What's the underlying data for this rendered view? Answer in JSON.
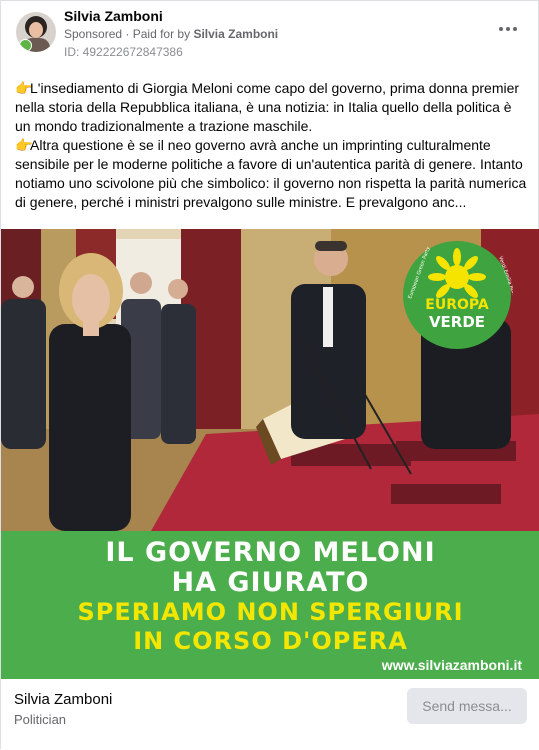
{
  "post": {
    "author": "Silvia Zamboni",
    "sponsored": "Sponsored",
    "paid_prefix": "Paid for by",
    "paid_by": "Silvia Zamboni",
    "library_id": "ID: 492222672847386",
    "paragraph1": "L'insediamento di Giorgia Meloni come capo del governo, prima donna premier nella storia della Repubblica italiana, è una notizia: in Italia quello della politica è un mondo tradizionalmente a trazione maschile.",
    "paragraph2": "Altra questione è se il neo governo avrà anche un imprinting culturalmente sensibile per le moderne politiche a favore di un'autentica parità di genere. Intanto notiamo uno scivolone più che simbolico: il governo non rispetta la parità numerica di genere, perché i ministri prevalgono sulle ministre. E prevalgono anc..."
  },
  "image": {
    "logo_line1": "EUROPA",
    "logo_line2": "VERDE",
    "logo_arc_left": "European Green Party",
    "logo_arc_right": "Verdi Emilia Romagna",
    "headline1": "IL GOVERNO MELONI",
    "headline2": "HA GIURATO",
    "headline3": "SPERIAMO NON SPERGIURI",
    "headline4": "IN CORSO D'OPERA",
    "website": "www.silviazamboni.it"
  },
  "footer": {
    "page_name": "Silvia Zamboni",
    "page_category": "Politician",
    "cta_label": "Send messa..."
  },
  "colors": {
    "banner_green": "#4cad4c",
    "headline_yellow": "#f3e600",
    "carpet_red": "#b0283a",
    "cta_bg": "#e4e6eb"
  },
  "icons": [
    "pointing-hand-icon",
    "more-options-icon",
    "verified-badge-icon"
  ]
}
